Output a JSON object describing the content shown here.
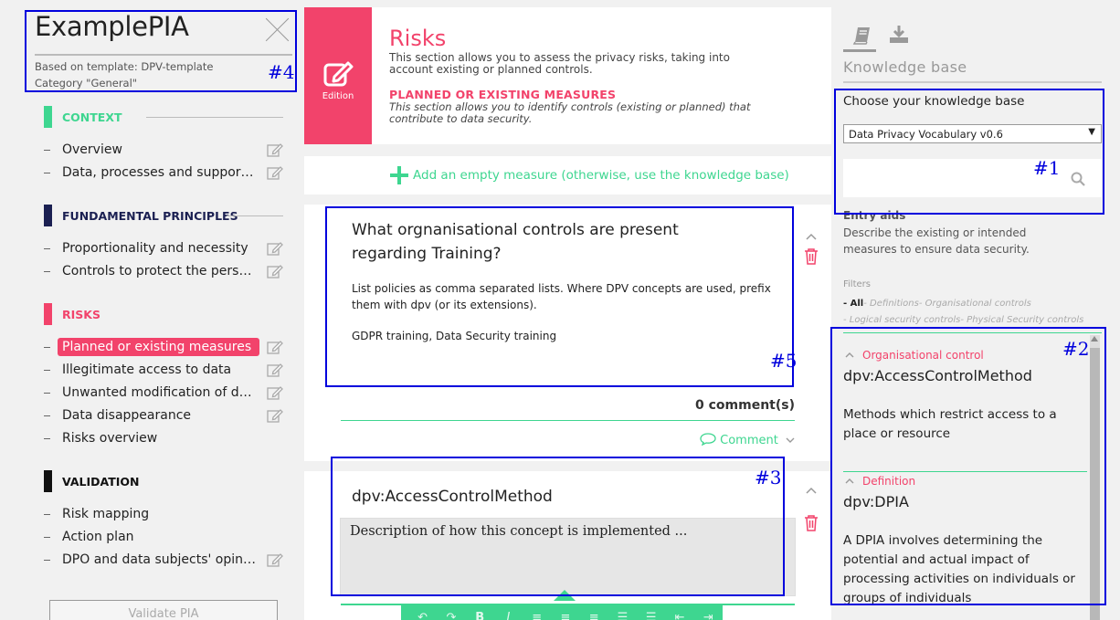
{
  "pia": {
    "title": "ExamplePIA",
    "template_line": "Based on template: DPV-template",
    "category_line": "Category \"General\""
  },
  "sidebar": {
    "sections": [
      {
        "label": "CONTEXT",
        "color": "#3ed690"
      },
      {
        "label": "FUNDAMENTAL PRINCIPLES",
        "color": "#1b2052"
      },
      {
        "label": "RISKS",
        "color": "#f2436b"
      },
      {
        "label": "VALIDATION",
        "color": "#111111"
      }
    ],
    "items": {
      "overview": "Overview",
      "data_processes": "Data, processes and supporting assets",
      "proportionality": "Proportionality and necessity",
      "controls_personal": "Controls to protect the personal data subjects' rights",
      "planned_measures": "Planned or existing measures",
      "illegitimate": "Illegitimate access to data",
      "unwanted": "Unwanted modification of data",
      "disappearance": "Data disappearance",
      "risks_overview": "Risks overview",
      "risk_mapping": "Risk mapping",
      "action_plan": "Action plan",
      "dpo_opinions": "DPO and data subjects' opinions"
    },
    "validate_label": "Validate PIA"
  },
  "hero": {
    "badge_label": "Edition",
    "title": "Risks",
    "description": "This section allows you to assess the privacy risks, taking into account existing or planned controls.",
    "subtitle": "PLANNED OR EXISTING MEASURES",
    "subdescription": "This section allows you to identify controls (existing or planned) that contribute to data security."
  },
  "add_measure_label": "Add an empty measure (otherwise, use the knowledge base)",
  "question_card": {
    "title": "What orgnanisational controls are present regarding Training?",
    "help": "List policies as comma separated lists. Where DPV concepts are used, prefix them with dpv (or its extensions).",
    "answer": "GDPR training, Data Security training",
    "comment_count": "0 comment(s)",
    "comment_label": "Comment"
  },
  "measure_card": {
    "title": "dpv:AccessControlMethod",
    "editor_text": "Description of how this concept is implemented ..."
  },
  "editor_toolbar": [
    "undo",
    "redo",
    "B",
    "I",
    "align-left",
    "align-center",
    "align-right",
    "bullet-list",
    "numbered-list",
    "outdent",
    "indent"
  ],
  "knowledge_base": {
    "title": "Knowledge base",
    "choose_label": "Choose your knowledge base",
    "selected": "Data Privacy Vocabulary v0.6",
    "search_placeholder": "",
    "entry_aids_title": "Entry aids",
    "entry_aids_desc": "Describe the existing or intended measures to ensure data security.",
    "filters_label": "Filters",
    "filter_all": "- All",
    "filter_line1": "- Definitions- Organisational controls",
    "filter_line2": "- Logical security controls- Physical Security controls",
    "items": [
      {
        "category": "Organisational control",
        "name": "dpv:AccessControlMethod",
        "description": "Methods which restrict access to a place or resource"
      },
      {
        "category": "Definition",
        "name": "dpv:DPIA",
        "description": "A DPIA involves determining the potential and actual impact of processing activities on individuals or groups of individuals"
      }
    ]
  },
  "annotations": {
    "a1": "#1",
    "a2": "#2",
    "a3": "#3",
    "a4": "#4",
    "a5": "#5"
  },
  "colors": {
    "accent_pink": "#f2436b",
    "accent_green": "#3ed690",
    "annotation_blue": "#0000dd"
  }
}
